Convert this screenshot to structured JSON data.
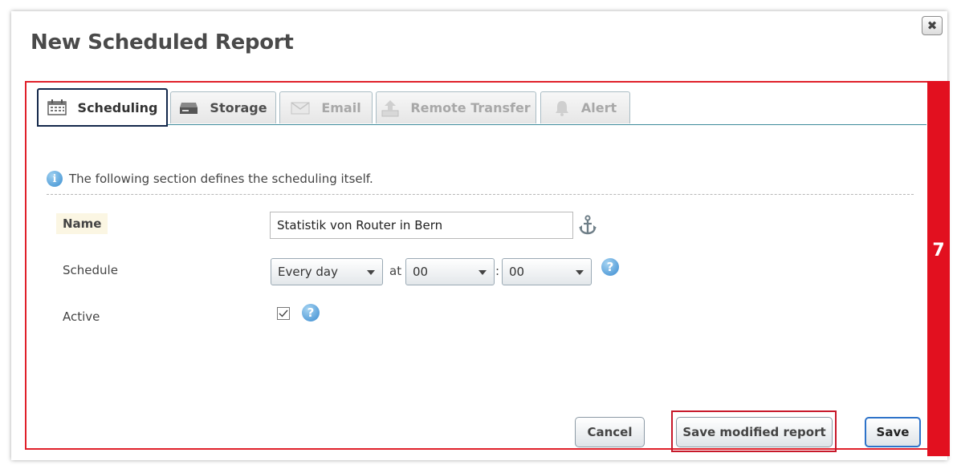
{
  "dialog": {
    "title": "New Scheduled Report",
    "close_icon": "close-icon"
  },
  "step_badge": "7",
  "tabs": [
    {
      "label": "Scheduling",
      "icon": "calendar-icon",
      "active": true
    },
    {
      "label": "Storage",
      "icon": "drive-icon",
      "active": false
    },
    {
      "label": "Email",
      "icon": "envelope-icon",
      "active": false
    },
    {
      "label": "Remote Transfer",
      "icon": "upload-icon",
      "active": false
    },
    {
      "label": "Alert",
      "icon": "bell-icon",
      "active": false
    }
  ],
  "section": {
    "info_text": "The following section defines the scheduling itself."
  },
  "form": {
    "name_label": "Name",
    "name_value": "Statistik von Router in Bern",
    "schedule_label": "Schedule",
    "schedule_frequency": "Every day",
    "at_label": "at",
    "hour": "00",
    "colon": ":",
    "minute": "00",
    "active_label": "Active",
    "active_checked": true,
    "help_glyph": "?"
  },
  "buttons": {
    "cancel": "Cancel",
    "save_modified": "Save modified report",
    "save": "Save"
  },
  "colors": {
    "highlight": "#e2101f",
    "tab_active_border": "#14284b",
    "accent_blue": "#3a8bd0"
  }
}
